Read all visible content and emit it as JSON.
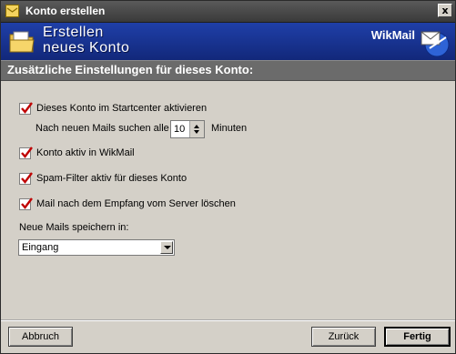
{
  "window": {
    "title": "Konto erstellen",
    "close_glyph": "x"
  },
  "banner": {
    "title_line1": "Erstellen",
    "title_line2": "neues Konto",
    "brand": "WikMail"
  },
  "section": {
    "title": "Zusätzliche Einstellungen für dieses Konto:"
  },
  "options": {
    "startcenter_label": "Dieses Konto im Startcenter aktivieren",
    "startcenter_checked": true,
    "interval_prefix": "Nach neuen Mails suchen alle",
    "interval_value": "10",
    "interval_suffix": "Minuten",
    "active_label": "Konto aktiv in WikMail",
    "active_checked": true,
    "spam_label": "Spam-Filter aktiv für dieses Konto",
    "spam_checked": true,
    "delete_label": "Mail nach dem Empfang vom Server löschen",
    "delete_checked": true,
    "store_label": "Neue Mails speichern in:",
    "store_value": "Eingang"
  },
  "buttons": {
    "cancel": "Abbruch",
    "back": "Zurück",
    "finish": "Fertig"
  },
  "colors": {
    "banner": "#1f3fa8",
    "section": "#6b6b6b",
    "checkmark": "#c00000"
  }
}
